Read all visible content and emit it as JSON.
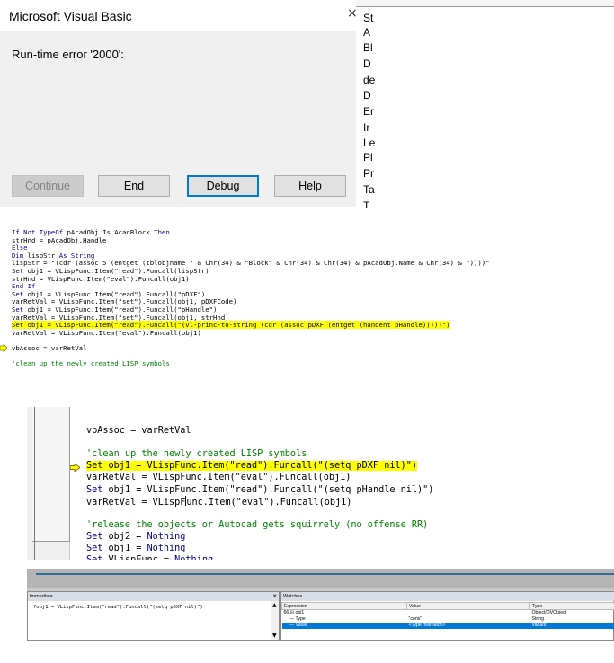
{
  "dialog": {
    "title": "Microsoft Visual Basic",
    "message": "Run-time error '2000':",
    "close_glyph": "×",
    "buttons": {
      "continue": "Continue",
      "end": "End",
      "debug": "Debug",
      "help": "Help"
    }
  },
  "background_doc": {
    "letters": [
      "St",
      "A",
      "Bl",
      "D",
      "de",
      "D",
      "Er",
      "Ir",
      "Le",
      "Pl",
      "Pr",
      "Ta",
      "T"
    ]
  },
  "code_listing": {
    "lines": [
      [
        {
          "t": "If Not TypeOf ",
          "k": "kw"
        },
        {
          "t": "pAcadObj "
        },
        {
          "t": "Is ",
          "k": "kw"
        },
        {
          "t": "AcadBlock "
        },
        {
          "t": "Then",
          "k": "kw"
        }
      ],
      [
        {
          "t": "strHnd = pAcadObj.Handle"
        }
      ],
      [
        {
          "t": "Else",
          "k": "kw"
        }
      ],
      [
        {
          "t": "Dim ",
          "k": "kw"
        },
        {
          "t": "lispStr "
        },
        {
          "t": "As String",
          "k": "kw"
        }
      ],
      [
        {
          "t": "lispStr = \"(cdr (assoc 5 (entget (tblobjname \" & Chr(34) & \"Block\" & Chr(34) & Chr(34) & pAcadObj.Name & Chr(34) & \"))))\""
        }
      ],
      [
        {
          "t": "Set ",
          "k": "kw"
        },
        {
          "t": "obj1 = VLispFunc.Item(\"read\").Funcall(lispStr)"
        }
      ],
      [
        {
          "t": "strHnd = VLispFunc.Item(\"eval\").Funcall(obj1)"
        }
      ],
      [
        {
          "t": "End If",
          "k": "kw"
        }
      ],
      [
        {
          "t": "Set ",
          "k": "kw"
        },
        {
          "t": "obj1 = VLispFunc.Item(\"read\").Funcall(\"pDXF\")"
        }
      ],
      [
        {
          "t": "varRetVal = VLispFunc.Item(\"set\").Funcall(obj1, pDXFCode)"
        }
      ],
      [
        {
          "t": "Set ",
          "k": "kw"
        },
        {
          "t": "obj1 = VLispFunc.Item(\"read\").Funcall(\"pHandle\")"
        }
      ],
      [
        {
          "t": "varRetVal = VLispFunc.Item(\"set\").Funcall(obj1, strHnd)"
        }
      ],
      [
        {
          "t": "Set obj1 = VLispFunc.Item(\"read\").Funcall(\"(vl-princ-to-string (cdr (assoc pDXF (entget (handent pHandle)))))\")",
          "k": "hl"
        }
      ],
      [
        {
          "t": "varRetVal = VLispFunc.Item(\"eval\").Funcall(obj1)"
        }
      ],
      [
        {
          "t": ""
        }
      ],
      [
        {
          "t": "vbAssoc = varRetVal"
        }
      ],
      [
        {
          "t": ""
        }
      ],
      [
        {
          "t": "'clean up the newly created LISP symbols",
          "k": "cm"
        }
      ]
    ]
  },
  "code_zoom": {
    "lines": [
      [
        {
          "t": "vbAssoc = varRetVal"
        }
      ],
      [
        {
          "t": ""
        }
      ],
      [
        {
          "t": "'clean up the newly created LISP symbols",
          "k": "cm"
        }
      ],
      [
        {
          "t": "Set obj1 = VLispFunc.Item(\"read\").Funcall(\"(setq pDXF nil)\")",
          "k": "hl"
        }
      ],
      [
        {
          "t": "varRetVal = VLispFunc.Item(\"eval\").Funcall(obj1)"
        }
      ],
      [
        {
          "t": "Set ",
          "k": "kw"
        },
        {
          "t": "obj1 = VLispFunc.Item(\"read\").Funcall(\"(setq pHandle nil)\")"
        }
      ],
      [
        {
          "t": "varRetVal = VLispF"
        },
        {
          "t": "",
          "k": "cursor"
        },
        {
          "t": "unc.Item(\"eval\").Funcall(obj1)"
        }
      ],
      [
        {
          "t": ""
        }
      ],
      [
        {
          "t": "'release the objects or Autocad gets squirrely (no offense RR)",
          "k": "cm"
        }
      ],
      [
        {
          "t": "Set ",
          "k": "kw"
        },
        {
          "t": "obj2 = "
        },
        {
          "t": "Nothing",
          "k": "kw"
        }
      ],
      [
        {
          "t": "Set ",
          "k": "kw"
        },
        {
          "t": "obj1 = "
        },
        {
          "t": "Nothing",
          "k": "kw"
        }
      ],
      [
        {
          "t": "Set ",
          "k": "kw"
        },
        {
          "t": "VLispFunc = "
        },
        {
          "t": "Nothing",
          "k": "kw"
        }
      ]
    ]
  },
  "immediate": {
    "title": "Immediate",
    "close_glyph": "×",
    "text": "?obj1 = VLispFunc.Item(\"read\").Funcall(\"(setq pDXF nil)\")",
    "scroll_up": "▲",
    "scroll_down": "▼"
  },
  "watches": {
    "title": "Watches",
    "columns": [
      "Expression",
      "Value",
      "Type"
    ],
    "rows": [
      {
        "expr": "66 ⊟ obj1",
        "value": "",
        "type": "Object/DVObject",
        "selected": false
      },
      {
        "expr": "   ├─ Type",
        "value": "\"cons\"",
        "type": "String",
        "selected": false
      },
      {
        "expr": "   └─ Value",
        "value": "<Type mismatch>",
        "type": "Variant",
        "selected": true
      }
    ]
  }
}
